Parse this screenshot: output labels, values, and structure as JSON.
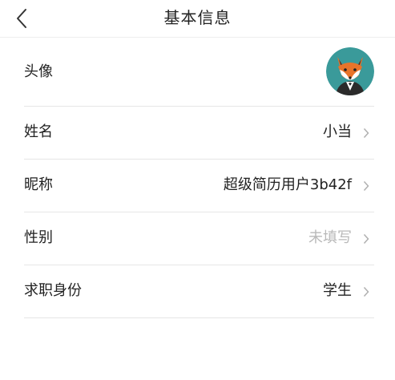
{
  "header": {
    "title": "基本信息",
    "back_icon": "chevron-left-icon"
  },
  "profile": {
    "avatar": {
      "label": "头像",
      "image": "fox-avatar",
      "background_color": "#3a9a9a"
    },
    "name": {
      "label": "姓名",
      "value": "小当"
    },
    "nickname": {
      "label": "昵称",
      "value": "超级简历用户3b42f"
    },
    "gender": {
      "label": "性别",
      "value": "未填写",
      "is_placeholder": true
    },
    "job_status": {
      "label": "求职身份",
      "value": "学生"
    }
  },
  "colors": {
    "placeholder_text": "#b9b9b9",
    "divider": "#e6e6e6",
    "chevron": "#b0b0b0"
  }
}
